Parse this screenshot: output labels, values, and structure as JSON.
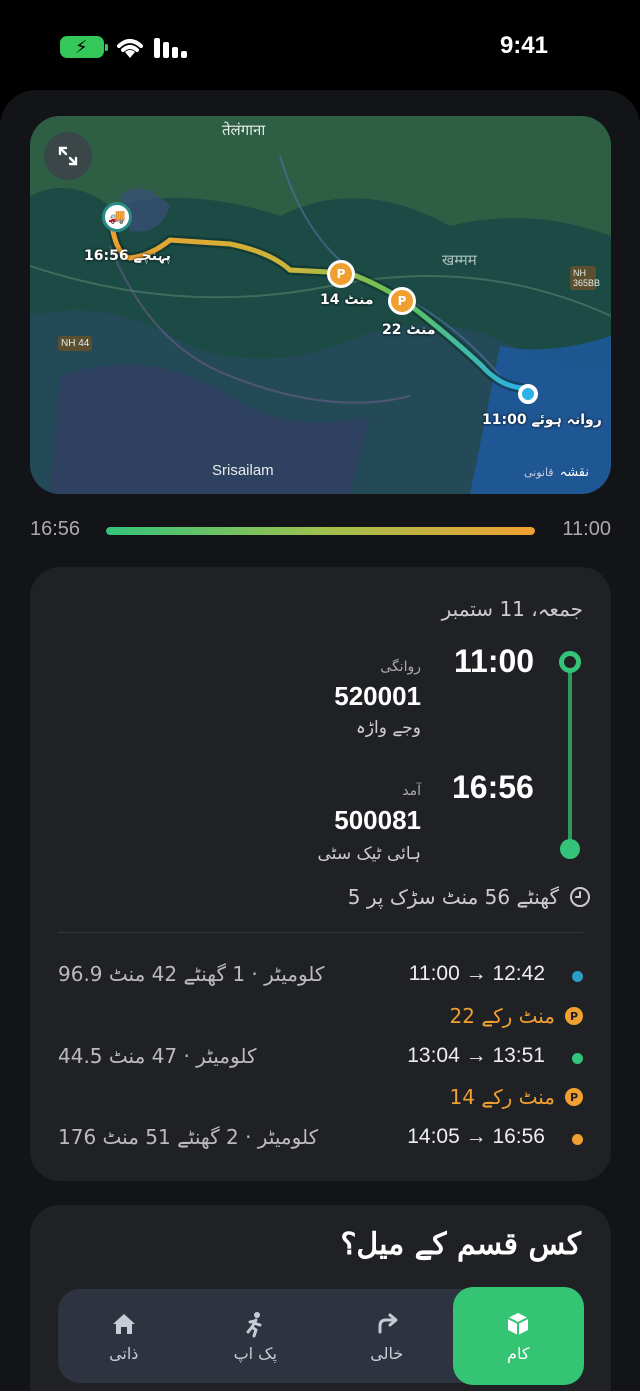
{
  "status_bar": {
    "time": "9:41"
  },
  "map": {
    "region_label": "तेलंगाना",
    "city_label": "खम्मम",
    "place_label": "Srisailam",
    "highway_left": "NH 44",
    "highway_right": "NH 365BB",
    "arrival_marker": "16:56 پہنچے",
    "stop1_marker": "14 منٹ",
    "stop2_marker": "22 منٹ",
    "departure_marker": "11:00 روانہ ہوئے",
    "legal_text": "نقشہ",
    "legal_sub": "قانونی"
  },
  "progress": {
    "left_time": "16:56",
    "right_time": "11:00",
    "fraction": 1.0
  },
  "trip": {
    "date": "جمعہ، 11 ستمبر",
    "departure": {
      "time": "11:00",
      "label": "روانگی",
      "code": "520001",
      "name": "وجے واڑہ"
    },
    "arrival": {
      "time": "16:56",
      "label": "آمد",
      "code": "500081",
      "name": "ہائی ٹیک سٹی"
    },
    "duration": "5 گھنٹے 56 منٹ سڑک پر",
    "legs": [
      {
        "range": "11:00 → 12:42",
        "dist": "96.9 کلومیٹر · 1 گھنٹے 42 منٹ",
        "color": "#2a9ec4"
      },
      {
        "range": "13:04 → 13:51",
        "dist": "44.5 کلومیٹر · 47 منٹ",
        "color": "#33c47a"
      },
      {
        "range": "14:05 → 16:56",
        "dist": "176 کلومیٹر · 2 گھنٹے 51 منٹ",
        "color": "#f0a030"
      }
    ],
    "stops": [
      "22 منٹ رکے",
      "14 منٹ رکے"
    ]
  },
  "kind": {
    "title": "کس قسم کے میل؟",
    "tabs": [
      {
        "label": "کام",
        "icon": "box-icon",
        "active": true
      },
      {
        "label": "خالی",
        "icon": "redo-arrow-icon",
        "active": false
      },
      {
        "label": "پک اپ",
        "icon": "walking-person-icon",
        "active": false
      },
      {
        "label": "ذاتی",
        "icon": "house-icon",
        "active": false
      }
    ]
  },
  "colors": {
    "accent_green": "#34c474",
    "orange": "#f0a030",
    "teal": "#2a8a86"
  }
}
